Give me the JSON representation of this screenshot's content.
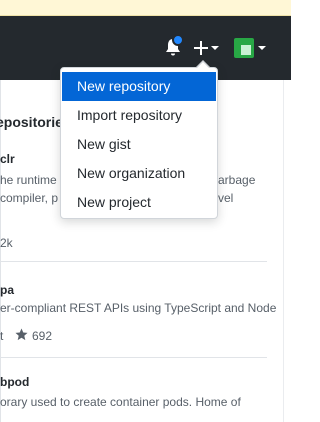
{
  "header": {
    "plus_menu": {
      "items": [
        {
          "label": "New repository",
          "active": true
        },
        {
          "label": "Import repository",
          "active": false
        },
        {
          "label": "New gist",
          "active": false
        },
        {
          "label": "New organization",
          "active": false
        },
        {
          "label": "New project",
          "active": false
        }
      ]
    },
    "icons": {
      "notifications": "bell-icon",
      "create": "plus-icon",
      "avatar": "avatar-icon"
    },
    "colors": {
      "topbar_bg": "#24292e",
      "menu_active_bg": "#0366d6",
      "notification_dot": "#2188ff",
      "avatar_green": "#28a745"
    }
  },
  "main": {
    "section_title": "epositories",
    "repos": [
      {
        "name": "clr",
        "desc_line1": "he runtime f",
        "desc_line1_right": "arbage",
        "desc_line2": "compiler, p",
        "desc_line2_right": "vel",
        "meta": "2k"
      },
      {
        "name": "pa",
        "desc_line1": "er-compliant REST APIs using TypeScript and Node",
        "meta_left": "t",
        "stars": "692"
      },
      {
        "name": "bpod",
        "desc_line1": "orary used to create container pods. Home of"
      }
    ]
  }
}
